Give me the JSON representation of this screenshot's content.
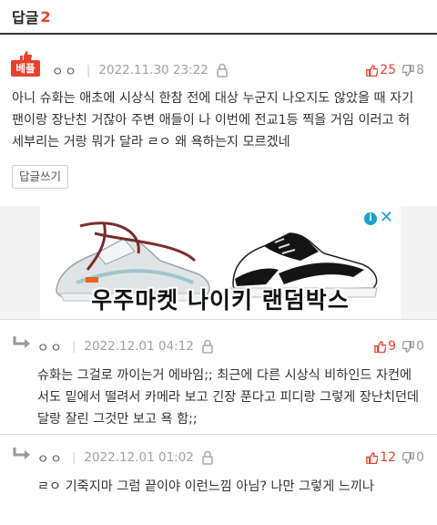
{
  "header": {
    "title": "답글",
    "count": "2"
  },
  "best_comment": {
    "badge_label": "베플",
    "nickname": "ㅇㅇ",
    "date": "2022.11.30 23:22",
    "upvotes": "25",
    "downvotes": "8",
    "lines": [
      "아니 슈화는 애초에 시상식 한참 전에 대상 누군지 나오지도 않았을 때 자기",
      "팬이랑 장난친 거잖아 주변 애들이 나 이번에 전교1등 찍을 거임 이러고 허",
      "세부리는 거랑 뭐가 달라 ㄹㅇ 왜 욕하는지 모르겠네"
    ],
    "reply_button": "답글쓰기"
  },
  "ad": {
    "text": "우주마켓 나이키 랜덤박스",
    "info_glyph": "i",
    "close_glyph": "✕"
  },
  "replies": [
    {
      "nickname": "ㅇㅇ",
      "date": "2022.12.01 04:12",
      "upvotes": "9",
      "downvotes": "0",
      "lines": [
        "슈화는 그걸로 까이는거 에바임;; 최근에 다른 시상식 비하인드 자컨에",
        "서도 밑에서 떨려서 카메라 보고 긴장 푼다고 피디랑 그렇게 장난치던데",
        "달랑 잘린 그것만 보고 욕 함;;"
      ]
    },
    {
      "nickname": "ㅇㅇ",
      "date": "2022.12.01 01:02",
      "upvotes": "12",
      "downvotes": "0",
      "lines": [
        "ㄹㅇ 기죽지마 그럼 끝이야 이런느낌 아님? 나만 그렇게 느끼나"
      ]
    }
  ],
  "colors": {
    "accent": "#e8412c",
    "muted": "#a0a0a0",
    "ad_icon": "#1a9fd4"
  },
  "icons": [
    "thumbs-up-icon",
    "thumbs-down-icon",
    "lock-icon",
    "reply-arrow-icon",
    "ad-info-icon",
    "close-icon",
    "sneaker-image"
  ]
}
